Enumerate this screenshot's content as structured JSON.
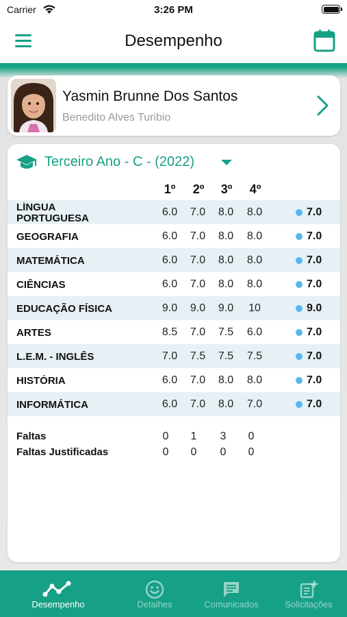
{
  "status_bar": {
    "carrier": "Carrier",
    "time": "3:26 PM"
  },
  "header": {
    "title": "Desempenho"
  },
  "student": {
    "name": "Yasmin Brunne Dos Santos",
    "school": "Benedito Alves Turibio"
  },
  "class_selector": {
    "label": "Terceiro Ano - C - (2022)"
  },
  "bimesters": [
    "1º",
    "2º",
    "3º",
    "4º"
  ],
  "subjects": [
    {
      "name": "LÍNGUA PORTUGUESA",
      "grades": [
        "6.0",
        "7.0",
        "8.0",
        "8.0"
      ],
      "average": "7.0"
    },
    {
      "name": "GEOGRAFIA",
      "grades": [
        "6.0",
        "7.0",
        "8.0",
        "8.0"
      ],
      "average": "7.0"
    },
    {
      "name": "MATEMÁTICA",
      "grades": [
        "6.0",
        "7.0",
        "8.0",
        "8.0"
      ],
      "average": "7.0"
    },
    {
      "name": "CIÊNCIAS",
      "grades": [
        "6.0",
        "7.0",
        "8.0",
        "8.0"
      ],
      "average": "7.0"
    },
    {
      "name": "EDUCAÇÃO FÍSICA",
      "grades": [
        "9.0",
        "9.0",
        "9.0",
        "10"
      ],
      "average": "9.0"
    },
    {
      "name": "ARTES",
      "grades": [
        "8.5",
        "7.0",
        "7.5",
        "6.0"
      ],
      "average": "7.0"
    },
    {
      "name": "L.E.M. - INGLÊS",
      "grades": [
        "7.0",
        "7.5",
        "7.5",
        "7.5"
      ],
      "average": "7.0"
    },
    {
      "name": "HISTÓRIA",
      "grades": [
        "6.0",
        "7.0",
        "8.0",
        "8.0"
      ],
      "average": "7.0"
    },
    {
      "name": "INFORMÁTICA",
      "grades": [
        "6.0",
        "7.0",
        "8.0",
        "7.0"
      ],
      "average": "7.0"
    }
  ],
  "absences": {
    "label": "Faltas",
    "values": [
      "0",
      "1",
      "3",
      "0"
    ],
    "justified_label": "Faltas Justificadas",
    "justified_values": [
      "0",
      "0",
      "0",
      "0"
    ]
  },
  "tabs": [
    {
      "label": "Desempenho",
      "icon": "chart-line-icon",
      "active": true
    },
    {
      "label": "Detalhes",
      "icon": "smiley-face-icon",
      "active": false
    },
    {
      "label": "Comunicados",
      "icon": "message-icon",
      "active": false
    },
    {
      "label": "Solicitações",
      "icon": "request-add-icon",
      "active": false
    }
  ],
  "colors": {
    "primary": "#16a085",
    "average_dot": "#55b5f0",
    "row_alt": "#e7f0f5",
    "muted_text": "#9a9a9a"
  }
}
